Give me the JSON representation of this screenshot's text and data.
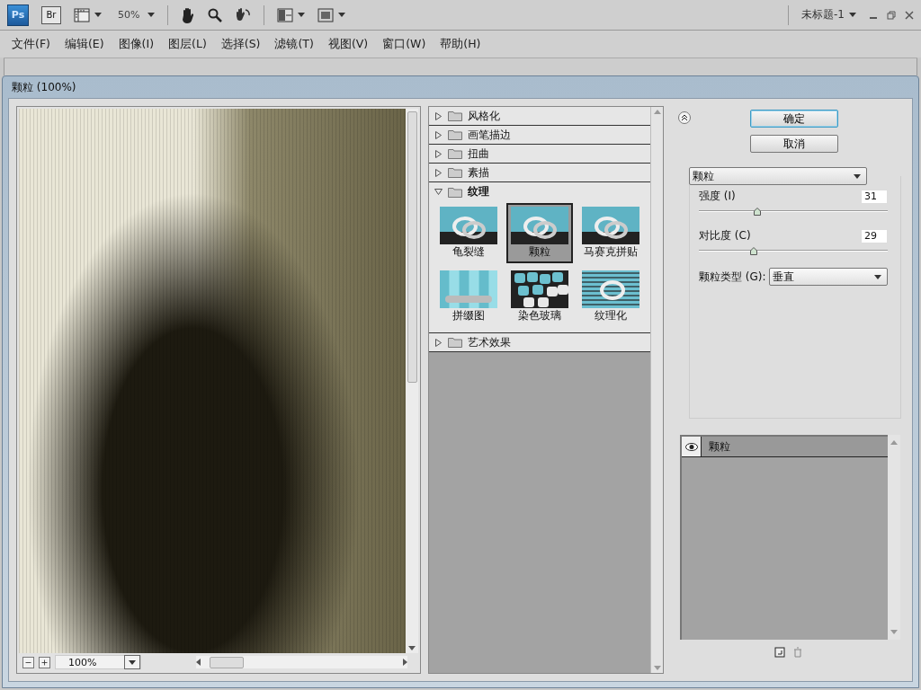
{
  "app_bar": {
    "logo": "Ps",
    "bridge": "Br",
    "zoom": "50%",
    "document": "未标题-1"
  },
  "menu": [
    {
      "label": "文件(F)"
    },
    {
      "label": "编辑(E)"
    },
    {
      "label": "图像(I)"
    },
    {
      "label": "图层(L)"
    },
    {
      "label": "选择(S)"
    },
    {
      "label": "滤镜(T)"
    },
    {
      "label": "视图(V)"
    },
    {
      "label": "窗口(W)"
    },
    {
      "label": "帮助(H)"
    }
  ],
  "dialog": {
    "title": "颗粒 (100%)",
    "preview": {
      "zoom": "100%"
    },
    "filter_groups": [
      {
        "label": "风格化",
        "expanded": false
      },
      {
        "label": "画笔描边",
        "expanded": false
      },
      {
        "label": "扭曲",
        "expanded": false
      },
      {
        "label": "素描",
        "expanded": false
      },
      {
        "label": "纹理",
        "expanded": true,
        "filters": [
          {
            "label": "龟裂缝",
            "selected": false,
            "kind": "rings"
          },
          {
            "label": "颗粒",
            "selected": true,
            "kind": "rings"
          },
          {
            "label": "马赛克拼贴",
            "selected": false,
            "kind": "rings"
          },
          {
            "label": "拼缀图",
            "selected": false,
            "kind": "tiles"
          },
          {
            "label": "染色玻璃",
            "selected": false,
            "kind": "cells"
          },
          {
            "label": "纹理化",
            "selected": false,
            "kind": "stripes"
          }
        ]
      },
      {
        "label": "艺术效果",
        "expanded": false
      }
    ],
    "buttons": {
      "ok": "确定",
      "cancel": "取消"
    },
    "filter_select": "颗粒",
    "params": [
      {
        "label": "强度 (I)",
        "value": "31",
        "level": 0.31
      },
      {
        "label": "对比度 (C)",
        "value": "29",
        "level": 0.29
      }
    ],
    "grain_type": {
      "label": "颗粒类型 (G):",
      "value": "垂直"
    },
    "effect_layers": [
      {
        "label": "颗粒",
        "visible": true
      }
    ]
  }
}
